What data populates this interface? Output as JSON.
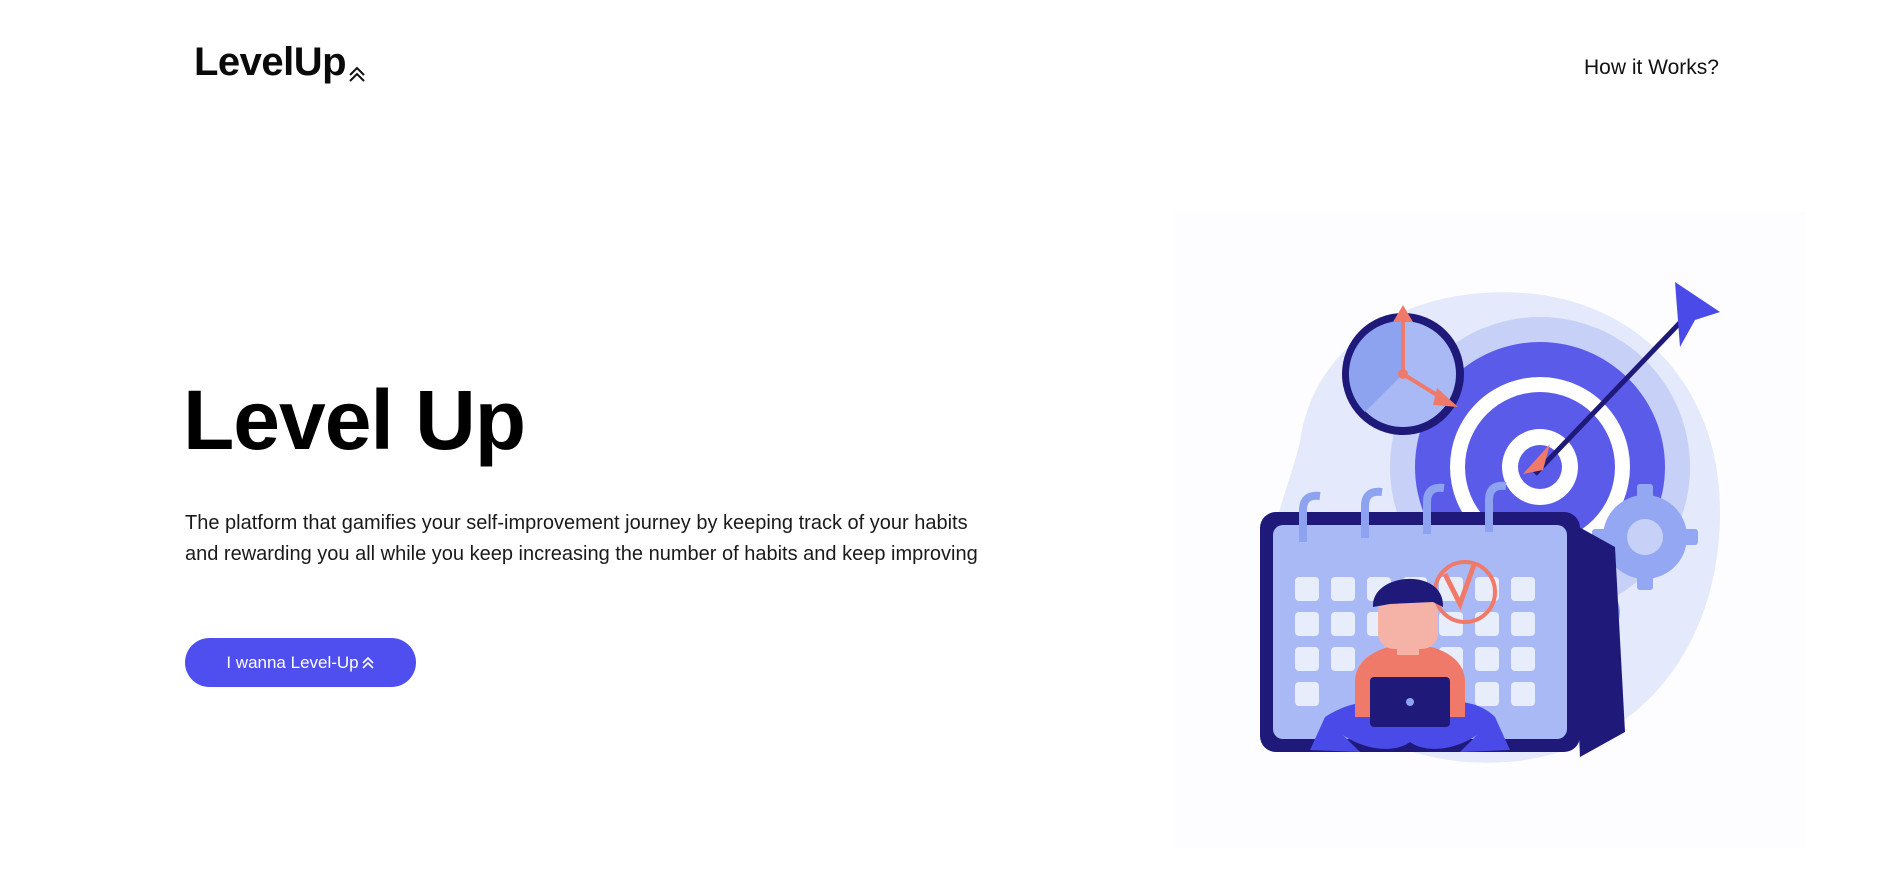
{
  "header": {
    "logo_text": "LevelUp",
    "nav": {
      "how_it_works": "How it Works?"
    }
  },
  "hero": {
    "title": "Level Up",
    "description": "The platform that gamifies your self-improvement journey by keeping track of your habits and rewarding you all while you keep increasing the number of habits and keep improving",
    "cta_label": "I wanna Level-Up"
  },
  "icons": {
    "logo_chevron": "double-chevron-up-icon",
    "cta_chevron": "double-chevron-up-icon"
  },
  "colors": {
    "accent": "#4f4ff0",
    "illustration_primary": "#5b5bea",
    "illustration_light": "#e4e9fb",
    "illustration_coral": "#f07a6a",
    "illustration_navy": "#1f1a7a"
  },
  "illustration": {
    "subject": "person-with-laptop-calendar-target-clock"
  }
}
